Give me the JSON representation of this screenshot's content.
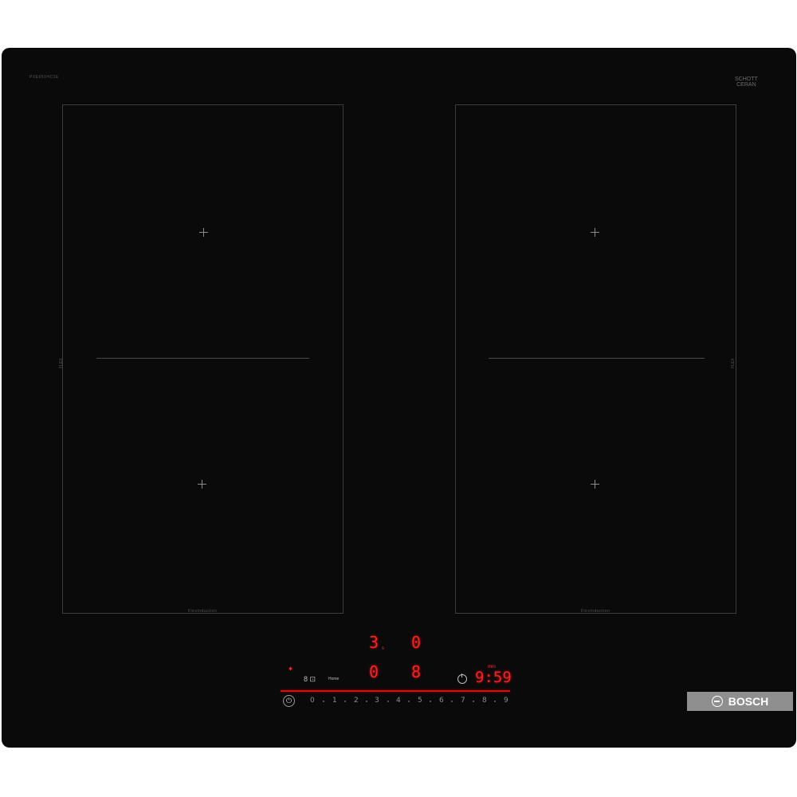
{
  "hob": {
    "model_label": "PXE651HC1E",
    "schott_label": "SCHOTT\nCERAN",
    "schott_sub": "——",
    "left_zone_side_label": "FLEX",
    "right_zone_side_label": "FLEX",
    "left_zone_bottom_label": "FlexInduction",
    "right_zone_bottom_label": "FlexInduction"
  },
  "display": {
    "top_left_value": "3",
    "top_left_suffix": "s",
    "top_right_value": "0",
    "mid_left_value": "0",
    "mid_right_value": "8",
    "timer_value": "9:59",
    "timer_unit": "min",
    "wifi_label": "Home",
    "indicator_icons": "8 ⊡",
    "scale_labels": [
      "0",
      "1",
      "2",
      "3",
      "4",
      "5",
      "6",
      "7",
      "8",
      "9"
    ],
    "accent_color": "#ff1f1f"
  },
  "brand": {
    "name": "BOSCH",
    "badge_color": "#8f8f8f"
  }
}
